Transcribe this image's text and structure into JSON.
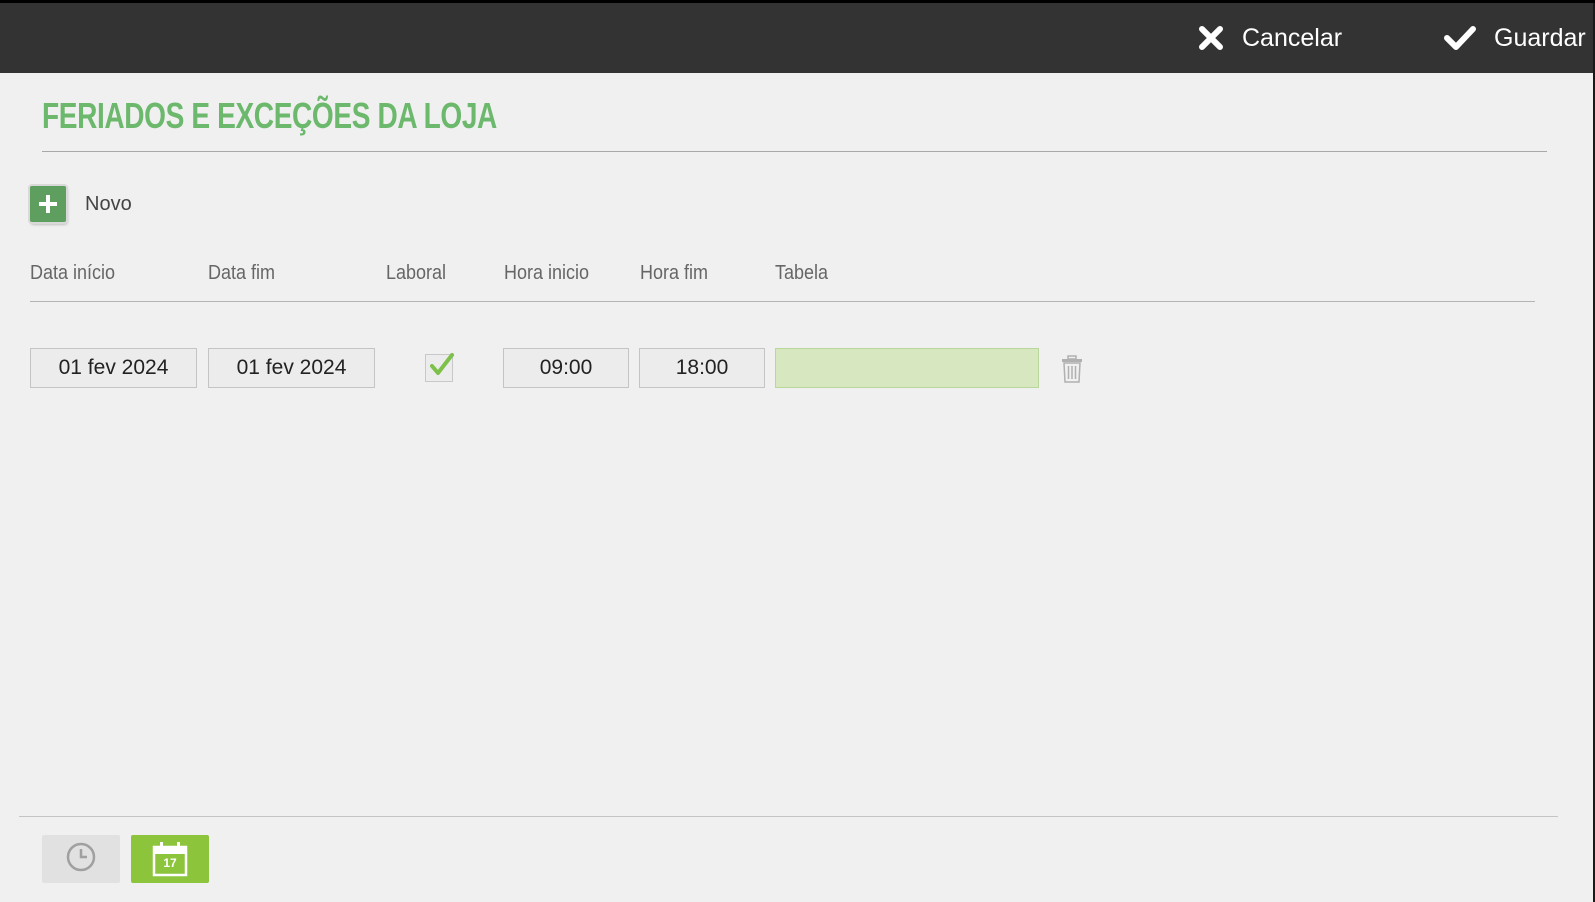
{
  "toolbar": {
    "cancel_label": "Cancelar",
    "save_label": "Guardar",
    "cancel_icon": "close-icon",
    "save_icon": "check-icon"
  },
  "page": {
    "title": "Feriados e Exceções da Loja",
    "new_label": "Novo"
  },
  "table": {
    "columns": [
      "Data início",
      "Data fim",
      "Laboral",
      "Hora inicio",
      "Hora fim",
      "Tabela"
    ],
    "rows": [
      {
        "start_date": "01 fev 2024",
        "end_date": "01 fev 2024",
        "laboral": true,
        "start_time": "09:00",
        "end_time": "18:00",
        "tabela": ""
      }
    ]
  },
  "bottom": {
    "clock_icon": "clock-icon",
    "calendar_icon": "calendar-icon",
    "calendar_day": "17",
    "active": "calendar"
  },
  "colors": {
    "topbar": "#333333",
    "title": "#6cb86c",
    "add_button": "#5e9e5e",
    "tabela_field": "#d7e8c0",
    "active_tab": "#8cc43c",
    "inactive_tab": "#e1e1e1"
  }
}
